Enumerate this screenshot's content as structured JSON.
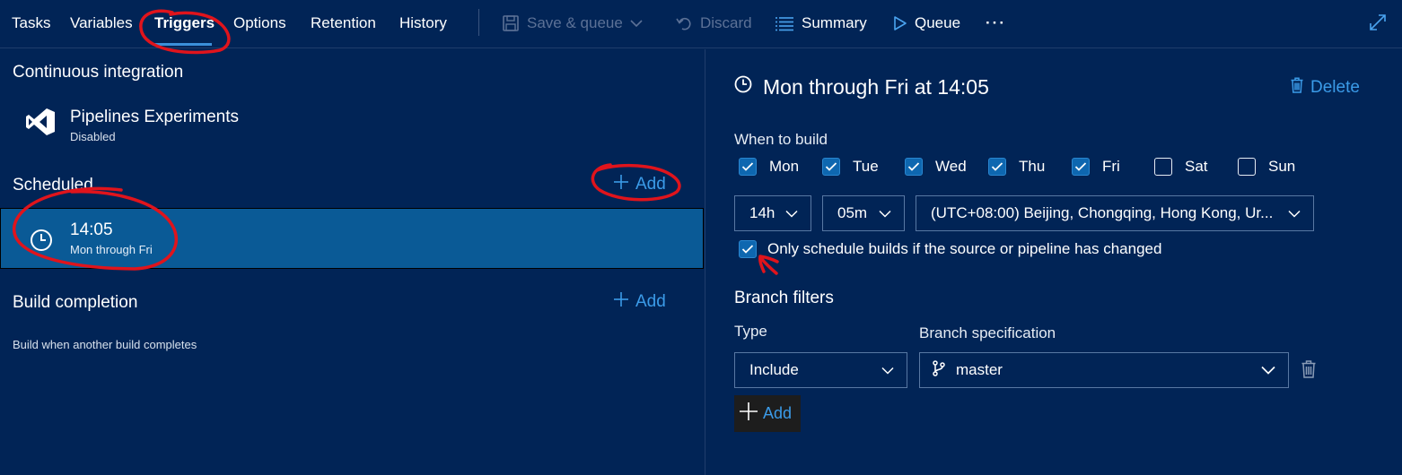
{
  "toolbar": {
    "tabs": [
      {
        "label": "Tasks"
      },
      {
        "label": "Variables"
      },
      {
        "label": "Triggers"
      },
      {
        "label": "Options"
      },
      {
        "label": "Retention"
      },
      {
        "label": "History"
      }
    ],
    "active_tab": "Triggers",
    "save_queue_label": "Save & queue",
    "discard_label": "Discard",
    "summary_label": "Summary",
    "queue_label": "Queue",
    "more_label": "···"
  },
  "left": {
    "ci_title": "Continuous integration",
    "ci_repo": {
      "name": "Pipelines Experiments",
      "status": "Disabled"
    },
    "scheduled_title": "Scheduled",
    "scheduled_add": "Add",
    "schedule_item": {
      "time": "14:05",
      "days": "Mon through Fri"
    },
    "build_completion_title": "Build completion",
    "build_completion_add": "Add",
    "build_completion_desc": "Build when another build completes"
  },
  "right": {
    "title": "Mon through Fri at 14:05",
    "delete_label": "Delete",
    "when_to_build": "When to build",
    "days": [
      {
        "label": "Mon",
        "checked": true
      },
      {
        "label": "Tue",
        "checked": true
      },
      {
        "label": "Wed",
        "checked": true
      },
      {
        "label": "Thu",
        "checked": true
      },
      {
        "label": "Fri",
        "checked": true
      },
      {
        "label": "Sat",
        "checked": false
      },
      {
        "label": "Sun",
        "checked": false
      }
    ],
    "hour": "14h",
    "minute": "05m",
    "timezone": "(UTC+08:00) Beijing, Chongqing, Hong Kong, Ur...",
    "only_changed_label": "Only schedule builds if the source or pipeline has changed",
    "only_changed_checked": true,
    "branch_filters_title": "Branch filters",
    "type_label": "Type",
    "type_value": "Include",
    "branch_spec_label": "Branch specification",
    "branch_spec_value": "master",
    "add_label": "Add"
  },
  "colors": {
    "background": "#012456",
    "accent": "#3b9be8",
    "selected_row": "#0a5a96",
    "annotation_red": "#e0141c"
  },
  "icons": [
    "save-icon",
    "undo-icon",
    "summary-list-icon",
    "play-icon",
    "expand-icon",
    "visual-studio-icon",
    "clock-icon",
    "trash-icon",
    "branch-icon",
    "chevron-down-icon",
    "plus-icon",
    "check-icon"
  ]
}
